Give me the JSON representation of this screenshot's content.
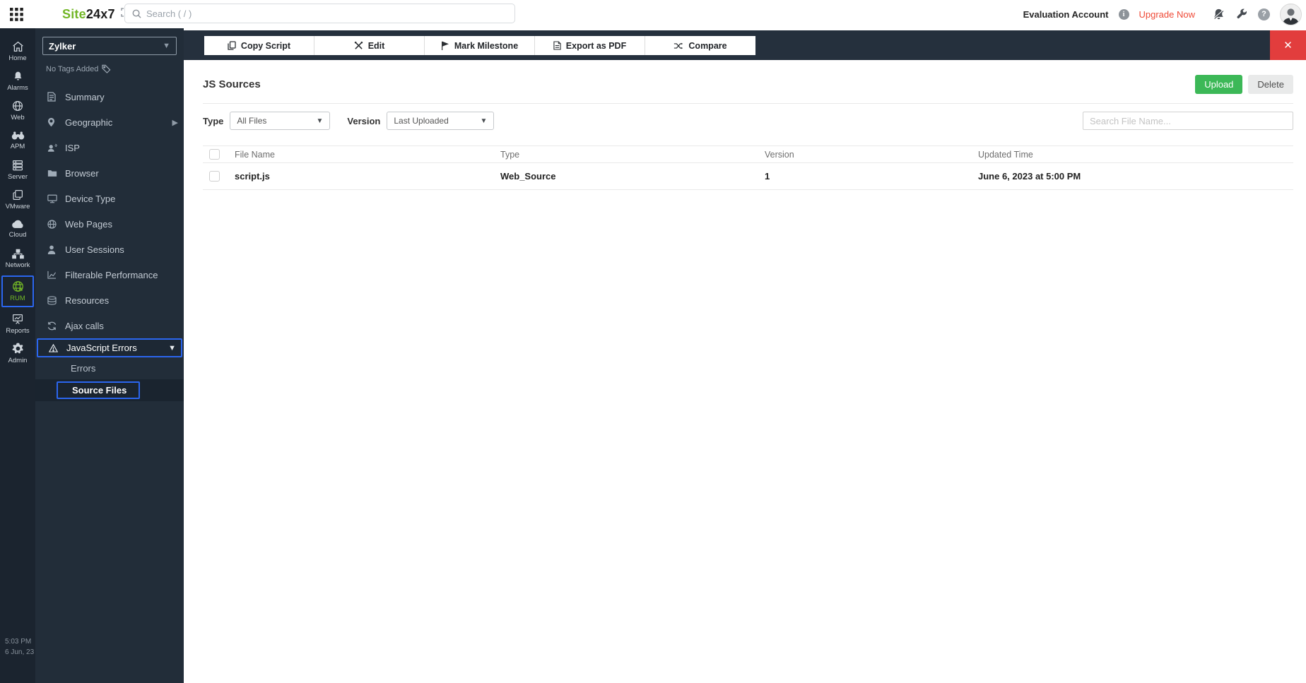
{
  "topbar": {
    "logo_prefix": "Site",
    "logo_suffix": "24x7",
    "search_placeholder": "Search ( / )",
    "account_label": "Evaluation Account",
    "upgrade_label": "Upgrade Now"
  },
  "rail": {
    "items": [
      {
        "label": "Home"
      },
      {
        "label": "Alarms"
      },
      {
        "label": "Web"
      },
      {
        "label": "APM"
      },
      {
        "label": "Server"
      },
      {
        "label": "VMware"
      },
      {
        "label": "Cloud"
      },
      {
        "label": "Network"
      },
      {
        "label": "RUM",
        "active": true
      },
      {
        "label": "Reports"
      },
      {
        "label": "Admin"
      }
    ],
    "footer_time": "5:03 PM",
    "footer_date": "6 Jun, 23"
  },
  "sidebar": {
    "monitor_name": "Zylker",
    "tags_label": "No Tags Added",
    "items": [
      "Summary",
      "Geographic",
      "ISP",
      "Browser",
      "Device Type",
      "Web Pages",
      "User Sessions",
      "Filterable Performance",
      "Resources",
      "Ajax calls",
      "JavaScript Errors"
    ],
    "sub_items": [
      "Errors",
      "Source Files"
    ],
    "active_item": "JavaScript Errors",
    "active_sub_item": "Source Files"
  },
  "toolbar": {
    "buttons": [
      "Copy Script",
      "Edit",
      "Mark Milestone",
      "Export as PDF",
      "Compare"
    ],
    "close_label": "✕"
  },
  "main": {
    "title": "JS Sources",
    "upload_label": "Upload",
    "delete_label": "Delete",
    "filters": {
      "type_label": "Type",
      "type_value": "All Files",
      "version_label": "Version",
      "version_value": "Last Uploaded"
    },
    "search_placeholder": "Search File Name...",
    "table": {
      "columns": [
        "File Name",
        "Type",
        "Version",
        "Updated Time"
      ],
      "rows": [
        {
          "file_name": "script.js",
          "type": "Web_Source",
          "version": "1",
          "updated": "June 6, 2023 at 5:00 PM"
        }
      ]
    }
  },
  "colors": {
    "brand_green": "#72b626",
    "selection_blue": "#2b66ef",
    "close_red": "#e23d3d",
    "upload_green": "#3cb857",
    "upgrade_red": "#ef4a37",
    "rail_bg": "#1b242f",
    "sidebar_bg": "#222d39",
    "band_bg": "#25303d"
  }
}
